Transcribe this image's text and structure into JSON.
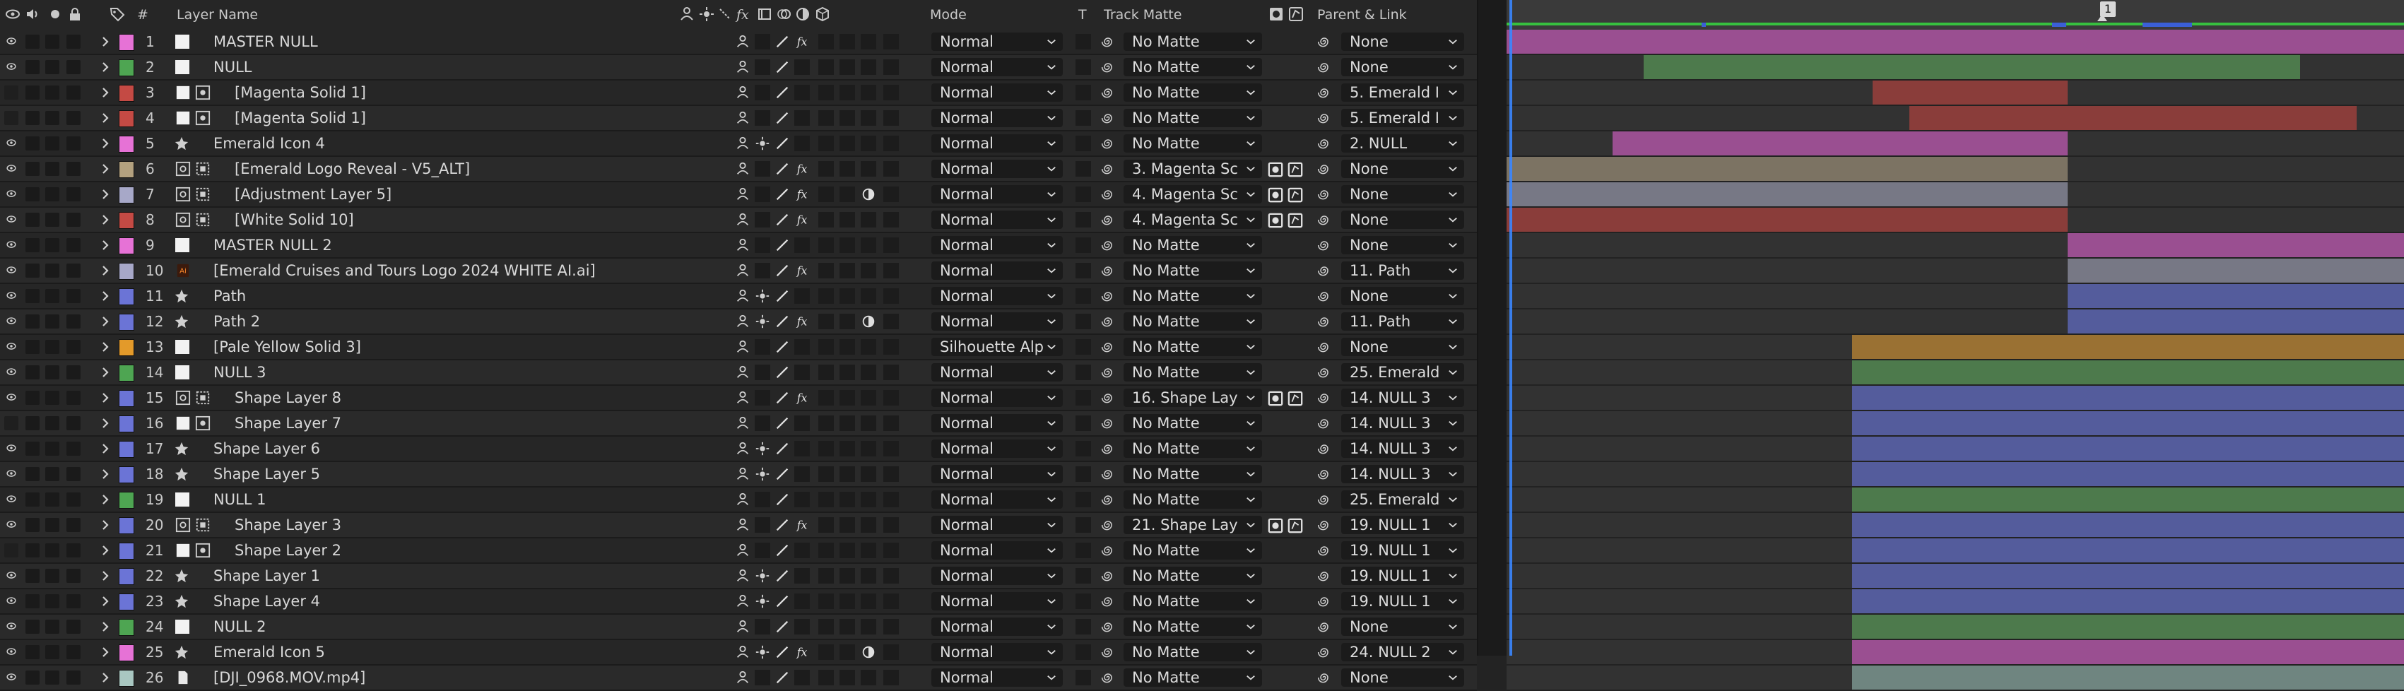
{
  "header": {
    "layer_name": "Layer Name",
    "num": "#",
    "mode": "Mode",
    "t": "T",
    "track_matte": "Track Matte",
    "parent_link": "Parent & Link",
    "fx": "fx"
  },
  "timeline": {
    "marker_label": "1"
  },
  "layers": [
    {
      "num": "1",
      "name": "MASTER NULL",
      "label_color": "#e672d6",
      "src": "white",
      "eye": true,
      "shy": false,
      "switch3": "fx",
      "mode": "Normal",
      "matte": "No Matte",
      "parent": "None",
      "bar_color": "#9a4f91",
      "bar_start": 0.0,
      "bar_end": 1.0,
      "matte_btn": false,
      "extra": ""
    },
    {
      "num": "2",
      "name": "NULL",
      "label_color": "#4ea552",
      "src": "white",
      "eye": true,
      "shy": false,
      "switch3": "",
      "mode": "Normal",
      "matte": "No Matte",
      "parent": "None",
      "bar_color": "#4d7a4c",
      "bar_start": 0.153,
      "bar_end": 0.884,
      "matte_btn": false,
      "extra": ""
    },
    {
      "num": "3",
      "name": "[Magenta Solid 1]",
      "label_color": "#c44a44",
      "src": "solid",
      "eye": false,
      "shy": false,
      "switch3": "",
      "mode": "Normal",
      "matte": "No Matte",
      "parent": "5. Emerald I",
      "bar_color": "#8a3d3a",
      "bar_start": 0.408,
      "bar_end": 0.625,
      "matte_btn": false,
      "extra": ""
    },
    {
      "num": "4",
      "name": "[Magenta Solid 1]",
      "label_color": "#c44a44",
      "src": "solid",
      "eye": false,
      "shy": false,
      "switch3": "",
      "mode": "Normal",
      "matte": "No Matte",
      "parent": "5. Emerald I",
      "bar_color": "#8a3d3a",
      "bar_start": 0.449,
      "bar_end": 0.947,
      "matte_btn": false,
      "extra": ""
    },
    {
      "num": "5",
      "name": "Emerald Icon 4",
      "label_color": "#e672d6",
      "src": "star",
      "eye": true,
      "shy": false,
      "switch3": "",
      "mode": "Normal",
      "matte": "No Matte",
      "parent": "2. NULL",
      "bar_color": "#9a4f91",
      "bar_start": 0.118,
      "bar_end": 0.625,
      "matte_btn": false,
      "extra": ""
    },
    {
      "num": "6",
      "name": "[Emerald Logo Reveal - V5_ALT]",
      "label_color": "#b3a17f",
      "src": "comp",
      "eye": true,
      "shy": false,
      "switch3": "fx",
      "mode": "Normal",
      "matte": "3. Magenta Sc",
      "parent": "None",
      "bar_color": "#7c7363",
      "bar_start": 0.0,
      "bar_end": 0.625,
      "matte_btn": true,
      "extra": ""
    },
    {
      "num": "7",
      "name": "[Adjustment Layer 5]",
      "label_color": "#a7a8c8",
      "src": "comp",
      "eye": true,
      "shy": false,
      "switch3": "fx",
      "mode": "Normal",
      "matte": "4. Magenta Sc",
      "parent": "None",
      "bar_color": "#777885",
      "bar_start": 0.0,
      "bar_end": 0.625,
      "matte_btn": true,
      "extra": "adj"
    },
    {
      "num": "8",
      "name": "[White Solid 10]",
      "label_color": "#c44a44",
      "src": "comp",
      "eye": true,
      "shy": false,
      "switch3": "fx",
      "mode": "Normal",
      "matte": "4. Magenta Sc",
      "parent": "None",
      "bar_color": "#8a3d3a",
      "bar_start": 0.0,
      "bar_end": 0.625,
      "matte_btn": true,
      "extra": ""
    },
    {
      "num": "9",
      "name": "MASTER NULL 2",
      "label_color": "#e672d6",
      "src": "white",
      "eye": true,
      "shy": false,
      "switch3": "",
      "mode": "Normal",
      "matte": "No Matte",
      "parent": "None",
      "bar_color": "#9a4f91",
      "bar_start": 0.625,
      "bar_end": 1.0,
      "matte_btn": false,
      "extra": ""
    },
    {
      "num": "10",
      "name": "[Emerald Cruises and Tours Logo 2024 WHITE AI.ai]",
      "label_color": "#a7a8c8",
      "src": "ai",
      "eye": true,
      "shy": false,
      "switch3": "fx",
      "mode": "Normal",
      "matte": "No Matte",
      "parent": "11. Path",
      "bar_color": "#777885",
      "bar_start": 0.625,
      "bar_end": 1.0,
      "matte_btn": false,
      "extra": ""
    },
    {
      "num": "11",
      "name": "Path",
      "label_color": "#6b74d6",
      "src": "star",
      "eye": true,
      "shy": false,
      "switch3": "",
      "mode": "Normal",
      "matte": "No Matte",
      "parent": "None",
      "bar_color": "#545c9c",
      "bar_start": 0.625,
      "bar_end": 1.0,
      "matte_btn": false,
      "extra": ""
    },
    {
      "num": "12",
      "name": "Path 2",
      "label_color": "#6b74d6",
      "src": "star",
      "eye": true,
      "shy": false,
      "switch3": "fx",
      "mode": "Normal",
      "matte": "No Matte",
      "parent": "11. Path",
      "bar_color": "#545c9c",
      "bar_start": 0.625,
      "bar_end": 1.0,
      "matte_btn": false,
      "extra": "adj"
    },
    {
      "num": "13",
      "name": "[Pale Yellow Solid 3]",
      "label_color": "#e39a2a",
      "src": "white",
      "eye": true,
      "shy": false,
      "switch3": "",
      "mode": "Silhouette Alp",
      "matte": "No Matte",
      "parent": "None",
      "bar_color": "#9a7133",
      "bar_start": 0.385,
      "bar_end": 1.0,
      "matte_btn": false,
      "extra": ""
    },
    {
      "num": "14",
      "name": "NULL 3",
      "label_color": "#4ea552",
      "src": "white",
      "eye": true,
      "shy": false,
      "switch3": "",
      "mode": "Normal",
      "matte": "No Matte",
      "parent": "25. Emerald",
      "bar_color": "#4d7a4c",
      "bar_start": 0.385,
      "bar_end": 1.0,
      "matte_btn": false,
      "extra": ""
    },
    {
      "num": "15",
      "name": "Shape Layer 8",
      "label_color": "#6b74d6",
      "src": "comp",
      "eye": true,
      "shy": false,
      "switch3": "fx",
      "mode": "Normal",
      "matte": "16. Shape Lay",
      "parent": "14. NULL 3",
      "bar_color": "#545c9c",
      "bar_start": 0.385,
      "bar_end": 1.0,
      "matte_btn": true,
      "extra": ""
    },
    {
      "num": "16",
      "name": "Shape Layer 7",
      "label_color": "#6b74d6",
      "src": "solid",
      "eye": false,
      "shy": false,
      "switch3": "",
      "mode": "Normal",
      "matte": "No Matte",
      "parent": "14. NULL 3",
      "bar_color": "#545c9c",
      "bar_start": 0.385,
      "bar_end": 1.0,
      "matte_btn": false,
      "extra": ""
    },
    {
      "num": "17",
      "name": "Shape Layer 6",
      "label_color": "#6b74d6",
      "src": "star",
      "eye": true,
      "shy": false,
      "switch3": "",
      "mode": "Normal",
      "matte": "No Matte",
      "parent": "14. NULL 3",
      "bar_color": "#545c9c",
      "bar_start": 0.385,
      "bar_end": 1.0,
      "matte_btn": false,
      "extra": ""
    },
    {
      "num": "18",
      "name": "Shape Layer 5",
      "label_color": "#6b74d6",
      "src": "star",
      "eye": true,
      "shy": false,
      "switch3": "",
      "mode": "Normal",
      "matte": "No Matte",
      "parent": "14. NULL 3",
      "bar_color": "#545c9c",
      "bar_start": 0.385,
      "bar_end": 1.0,
      "matte_btn": false,
      "extra": ""
    },
    {
      "num": "19",
      "name": "NULL 1",
      "label_color": "#4ea552",
      "src": "white",
      "eye": true,
      "shy": false,
      "switch3": "",
      "mode": "Normal",
      "matte": "No Matte",
      "parent": "25. Emerald",
      "bar_color": "#4d7a4c",
      "bar_start": 0.385,
      "bar_end": 1.0,
      "matte_btn": false,
      "extra": ""
    },
    {
      "num": "20",
      "name": "Shape Layer 3",
      "label_color": "#6b74d6",
      "src": "comp",
      "eye": true,
      "shy": false,
      "switch3": "fx",
      "mode": "Normal",
      "matte": "21. Shape Lay",
      "parent": "19. NULL 1",
      "bar_color": "#545c9c",
      "bar_start": 0.385,
      "bar_end": 1.0,
      "matte_btn": true,
      "extra": ""
    },
    {
      "num": "21",
      "name": "Shape Layer 2",
      "label_color": "#6b74d6",
      "src": "solid",
      "eye": false,
      "shy": false,
      "switch3": "",
      "mode": "Normal",
      "matte": "No Matte",
      "parent": "19. NULL 1",
      "bar_color": "#545c9c",
      "bar_start": 0.385,
      "bar_end": 1.0,
      "matte_btn": false,
      "extra": ""
    },
    {
      "num": "22",
      "name": "Shape Layer 1",
      "label_color": "#6b74d6",
      "src": "star",
      "eye": true,
      "shy": false,
      "switch3": "",
      "mode": "Normal",
      "matte": "No Matte",
      "parent": "19. NULL 1",
      "bar_color": "#545c9c",
      "bar_start": 0.385,
      "bar_end": 1.0,
      "matte_btn": false,
      "extra": ""
    },
    {
      "num": "23",
      "name": "Shape Layer 4",
      "label_color": "#6b74d6",
      "src": "star",
      "eye": true,
      "shy": false,
      "switch3": "",
      "mode": "Normal",
      "matte": "No Matte",
      "parent": "19. NULL 1",
      "bar_color": "#545c9c",
      "bar_start": 0.385,
      "bar_end": 1.0,
      "matte_btn": false,
      "extra": ""
    },
    {
      "num": "24",
      "name": "NULL 2",
      "label_color": "#4ea552",
      "src": "white",
      "eye": true,
      "shy": false,
      "switch3": "",
      "mode": "Normal",
      "matte": "No Matte",
      "parent": "None",
      "bar_color": "#4d7a4c",
      "bar_start": 0.385,
      "bar_end": 1.0,
      "matte_btn": false,
      "extra": ""
    },
    {
      "num": "25",
      "name": "Emerald Icon 5",
      "label_color": "#e672d6",
      "src": "star",
      "eye": true,
      "shy": false,
      "switch3": "fx",
      "mode": "Normal",
      "matte": "No Matte",
      "parent": "24. NULL 2",
      "bar_color": "#9a4f91",
      "bar_start": 0.385,
      "bar_end": 1.0,
      "matte_btn": false,
      "extra": "adj"
    },
    {
      "num": "26",
      "name": "[DJI_0968.MOV.mp4]",
      "label_color": "#a9c7c1",
      "src": "file",
      "eye": true,
      "shy": false,
      "switch3": "",
      "mode": "Normal",
      "matte": "No Matte",
      "parent": "None",
      "bar_color": "#6f8580",
      "bar_start": 0.385,
      "bar_end": 1.0,
      "matte_btn": false,
      "extra": ""
    }
  ]
}
